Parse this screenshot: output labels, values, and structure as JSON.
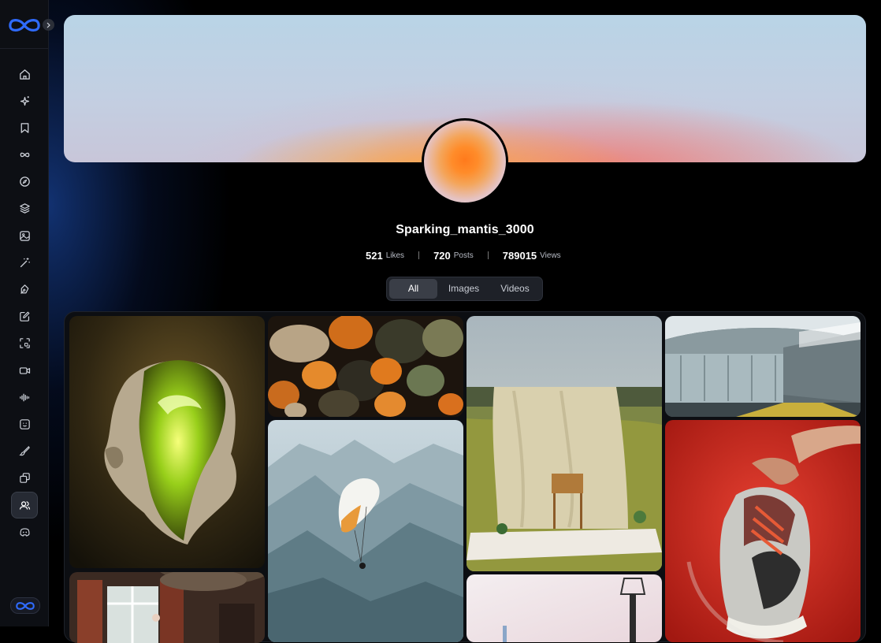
{
  "app": {
    "nav_items": [
      {
        "name": "home-icon"
      },
      {
        "name": "sparkles-icon"
      },
      {
        "name": "bookmark-icon"
      },
      {
        "name": "infinity-icon"
      },
      {
        "name": "compass-icon"
      },
      {
        "name": "layers-icon"
      },
      {
        "name": "image-icon"
      },
      {
        "name": "magic-wand-icon"
      },
      {
        "name": "pen-tool-icon"
      },
      {
        "name": "edit-icon"
      },
      {
        "name": "crop-icon"
      },
      {
        "name": "video-icon"
      },
      {
        "name": "audio-wave-icon"
      },
      {
        "name": "face-icon"
      },
      {
        "name": "brush-icon"
      },
      {
        "name": "gallery-add-icon"
      },
      {
        "name": "users-icon",
        "active": true
      },
      {
        "name": "discord-icon"
      }
    ],
    "accent_color": "#2f6bff"
  },
  "profile": {
    "username": "Sparking_mantis_3000",
    "stats": {
      "likes_value": "521",
      "likes_label": "Likes",
      "posts_value": "720",
      "posts_label": "Posts",
      "views_value": "789015",
      "views_label": "Views"
    },
    "tabs": {
      "all": "All",
      "images": "Images",
      "videos": "Videos",
      "active": "All"
    }
  },
  "gallery": {
    "items": [
      {
        "name": "gallery-item-glowing-head"
      },
      {
        "name": "gallery-item-pumpkins"
      },
      {
        "name": "gallery-item-picnic-tent"
      },
      {
        "name": "gallery-item-subway-tunnel"
      },
      {
        "name": "gallery-item-paraglider"
      },
      {
        "name": "gallery-item-sneaker"
      },
      {
        "name": "gallery-item-room-window"
      },
      {
        "name": "gallery-item-street-lamp"
      }
    ]
  }
}
